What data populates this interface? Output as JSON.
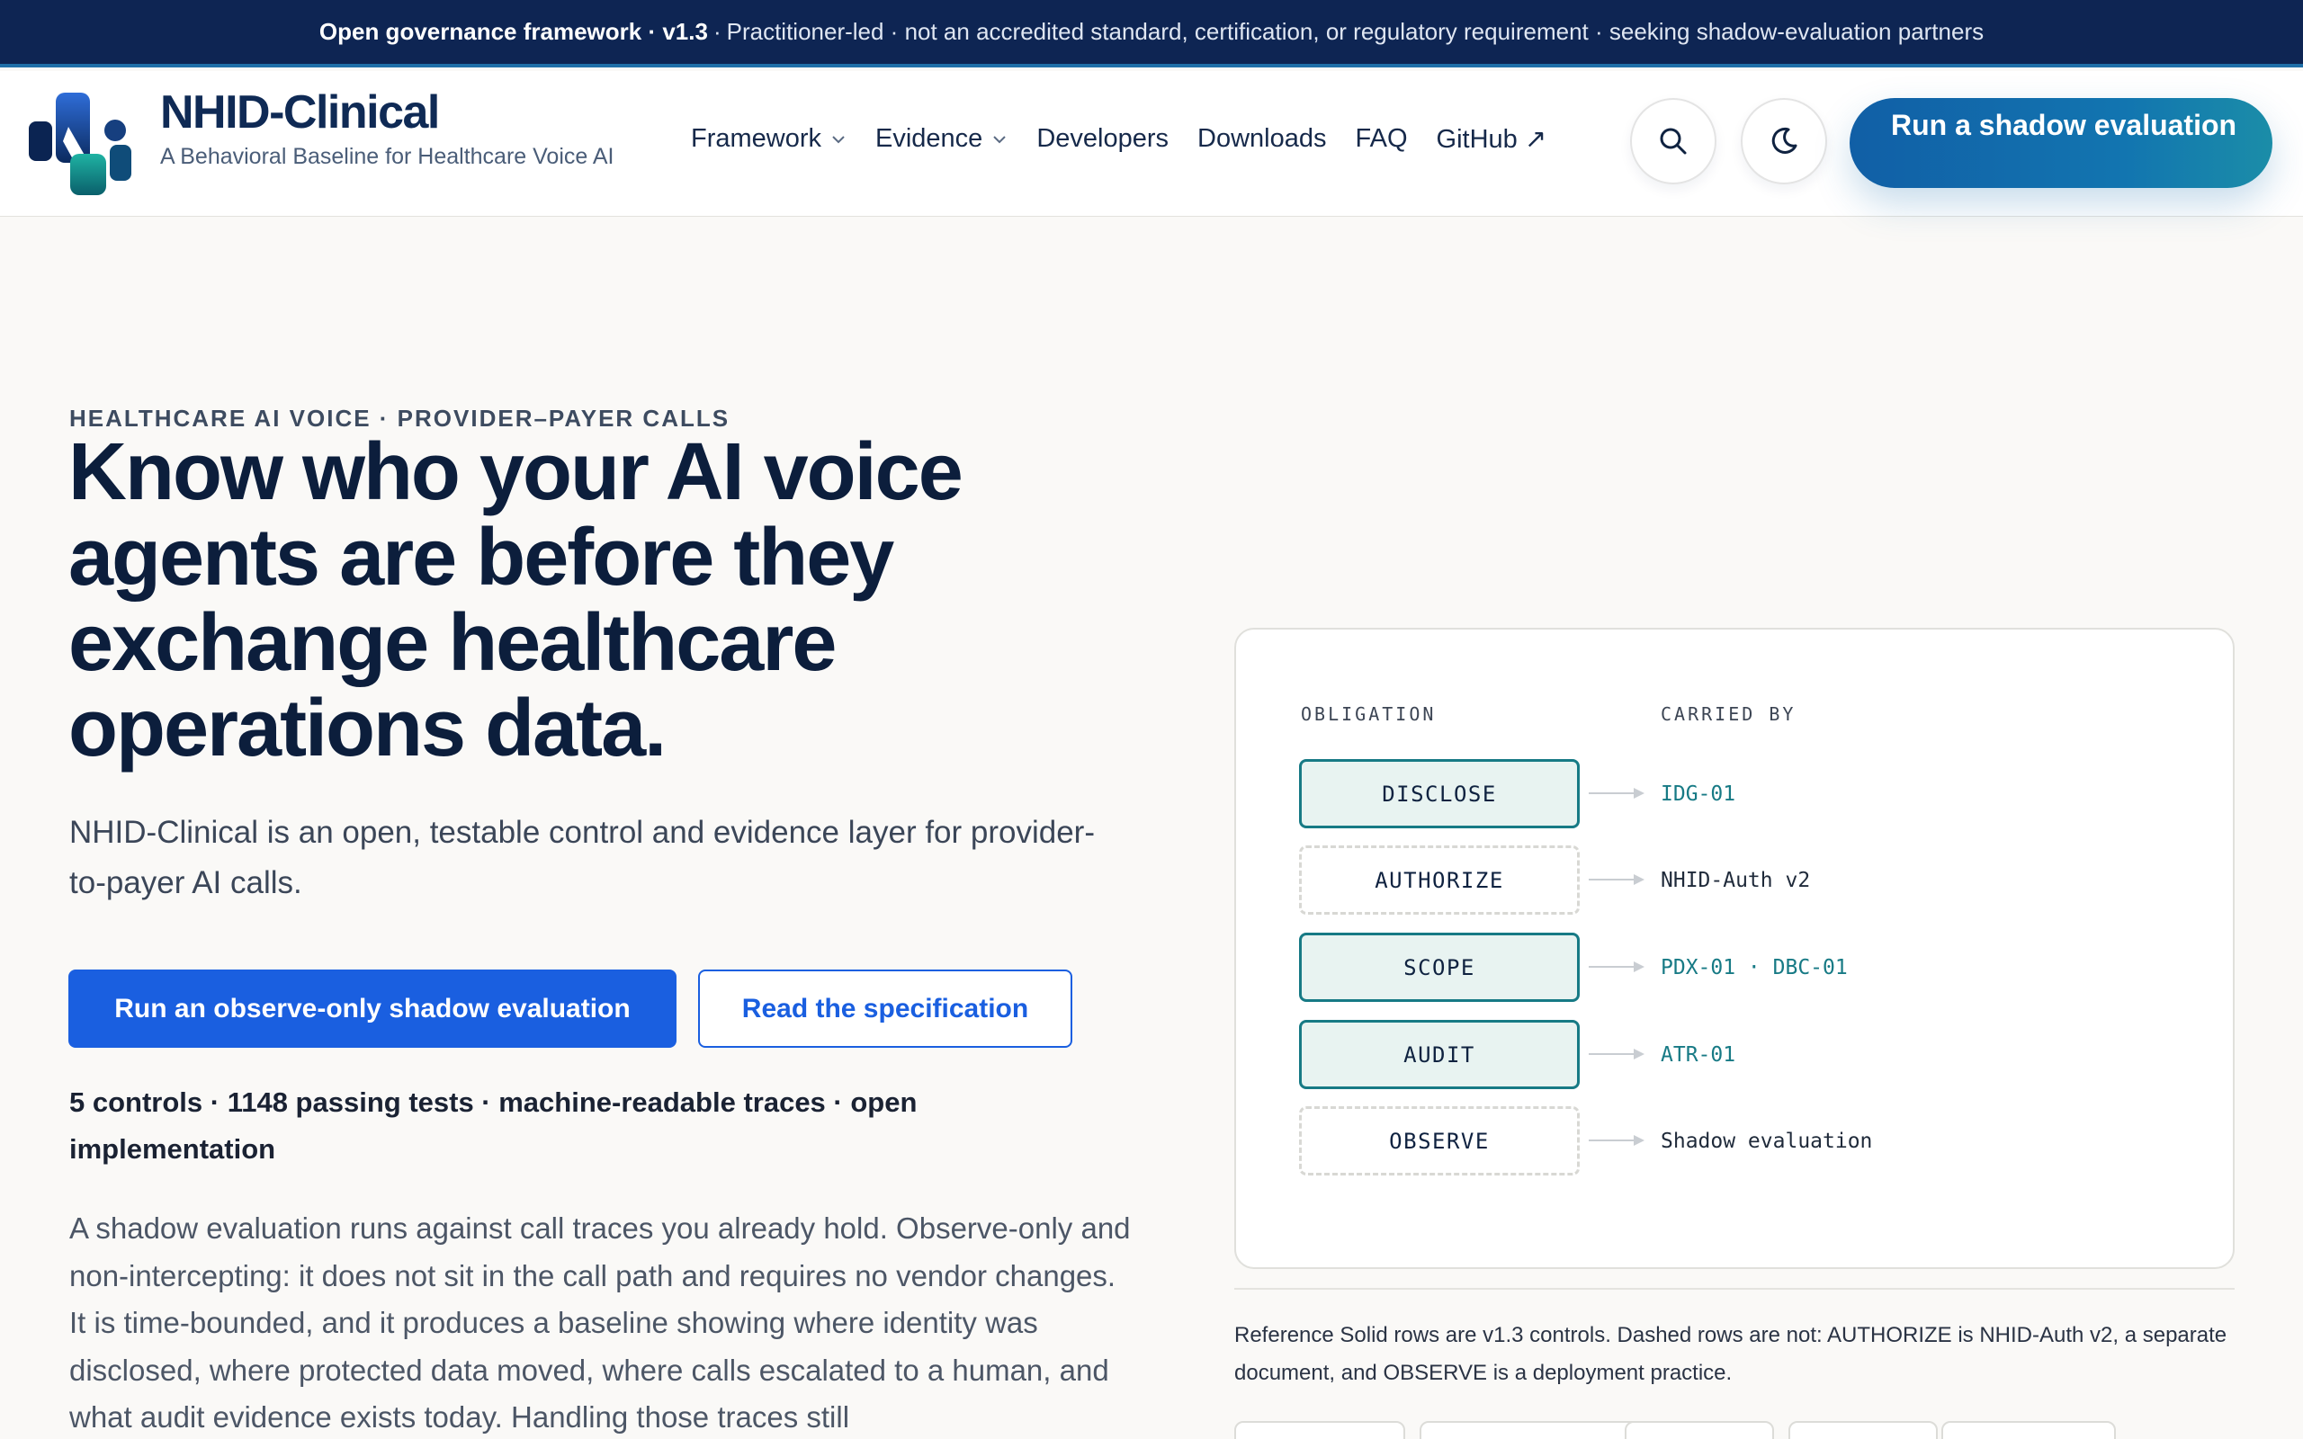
{
  "announcement": {
    "strong": "Open governance framework · v1.3",
    "rest": "Practitioner-led · not an accredited standard, certification, or regulatory requirement · seeking shadow-evaluation partners"
  },
  "brand": {
    "title": "NHID-Clinical",
    "subtitle": "A Behavioral Baseline for Healthcare Voice AI"
  },
  "nav": {
    "items": [
      {
        "label": "Framework",
        "dropdown": true
      },
      {
        "label": "Evidence",
        "dropdown": true
      },
      {
        "label": "Developers",
        "dropdown": false
      },
      {
        "label": "Downloads",
        "dropdown": false
      },
      {
        "label": "FAQ",
        "dropdown": false
      },
      {
        "label": "GitHub ↗",
        "dropdown": false
      }
    ],
    "cta": "Run a shadow evaluation"
  },
  "hero": {
    "eyebrow": "HEALTHCARE AI VOICE · PROVIDER–PAYER CALLS",
    "title": "Know who your AI voice agents are before they exchange healthcare operations data.",
    "lead": "NHID-Clinical is an open, testable control and evidence layer for provider-to-payer AI calls.",
    "primary_button": "Run an observe-only shadow evaluation",
    "secondary_button": "Read the specification",
    "stats": "5 controls · 1148 passing tests · machine-readable traces · open implementation",
    "body": "A shadow evaluation runs against call traces you already hold. Observe-only and non-intercepting: it does not sit in the call path and requires no vendor changes. It is time-bounded, and it produces a baseline showing where identity was disclosed, where protected data moved, where calls escalated to a human, and what audit evidence exists today. Handling those traces still"
  },
  "diagram": {
    "col_obligation": "OBLIGATION",
    "col_carried_by": "CARRIED BY",
    "rows": [
      {
        "obligation": "DISCLOSE",
        "carrier": "IDG-01",
        "solid": true
      },
      {
        "obligation": "AUTHORIZE",
        "carrier": "NHID-Auth v2",
        "solid": false
      },
      {
        "obligation": "SCOPE",
        "carrier": "PDX-01 · DBC-01",
        "solid": true
      },
      {
        "obligation": "AUDIT",
        "carrier": "ATR-01",
        "solid": true
      },
      {
        "obligation": "OBSERVE",
        "carrier": "Shadow evaluation",
        "solid": false
      }
    ],
    "caption": "Reference Solid rows are v1.3 controls. Dashed rows are not: AUTHORIZE is NHID-Auth v2, a separate document, and OBSERVE is a deployment practice."
  },
  "colors": {
    "navy": "#0e2553",
    "primary": "#1a5fe0",
    "teal": "#177a85",
    "background": "#faf9f7"
  },
  "icons": {
    "search": "search-icon",
    "theme": "moon-icon",
    "chevron": "chevron-down-icon",
    "logo": "nhid-logo-icon"
  }
}
